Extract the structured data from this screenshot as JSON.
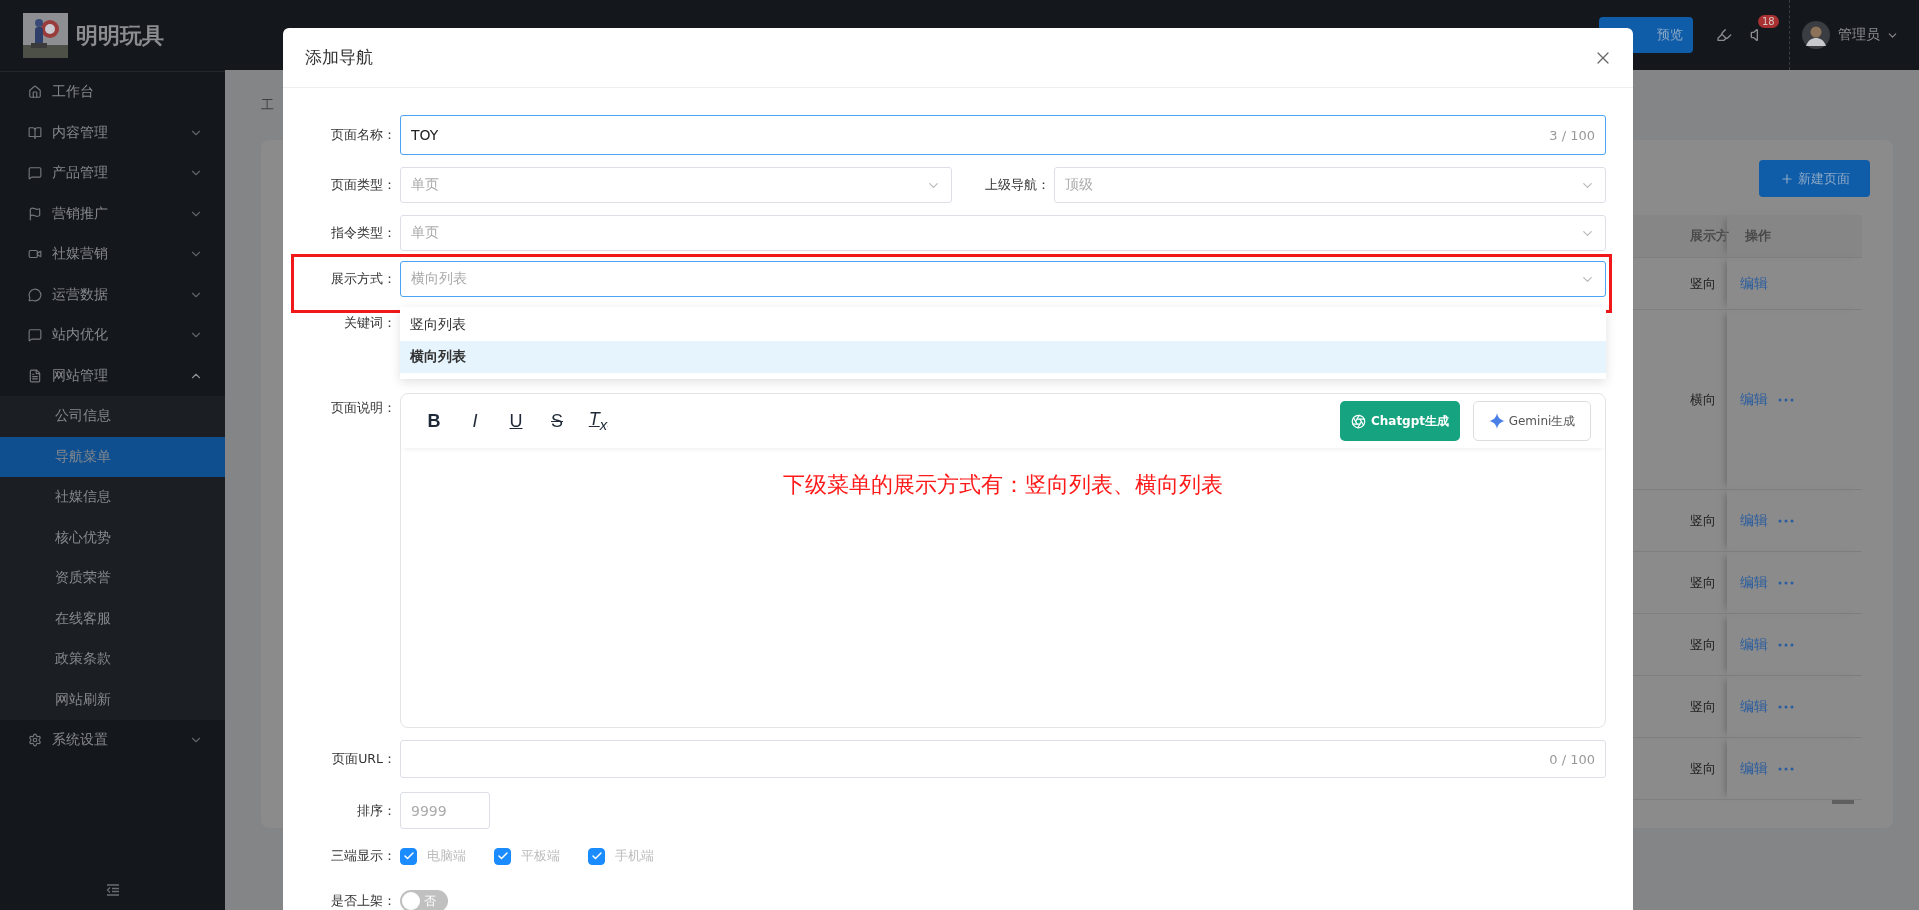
{
  "sidebar": {
    "brand": "明明玩具",
    "items": [
      {
        "label": "工作台",
        "kind": "home"
      },
      {
        "label": "内容管理",
        "kind": "book",
        "expanded": false
      },
      {
        "label": "产品管理",
        "kind": "card",
        "expanded": false
      },
      {
        "label": "营销推广",
        "kind": "flag",
        "expanded": false
      },
      {
        "label": "社媒营销",
        "kind": "video",
        "expanded": false
      },
      {
        "label": "运营数据",
        "kind": "chat",
        "expanded": false
      },
      {
        "label": "站内优化",
        "kind": "card",
        "expanded": false
      },
      {
        "label": "网站管理",
        "kind": "file",
        "expanded": true,
        "children": [
          {
            "label": "公司信息",
            "selected": false
          },
          {
            "label": "导航菜单",
            "selected": true
          },
          {
            "label": "社媒信息",
            "selected": false
          },
          {
            "label": "核心优势",
            "selected": false
          },
          {
            "label": "资质荣誉",
            "selected": false
          },
          {
            "label": "在线客服",
            "selected": false
          },
          {
            "label": "政策条款",
            "selected": false
          },
          {
            "label": "网站刷新",
            "selected": false
          }
        ]
      },
      {
        "label": "系统设置",
        "kind": "gear",
        "expanded": false
      }
    ]
  },
  "topbar": {
    "preview_button": "预览",
    "notification_count": "18",
    "user": "管理员"
  },
  "breadcrumb": "工",
  "page": {
    "new_button": "新建页面",
    "table": {
      "columns": [
        "展示方",
        "操作"
      ],
      "rows": [
        {
          "display": "竖向",
          "action": "编辑",
          "more": false
        },
        {
          "display": "横向",
          "action": "编辑",
          "more": true
        },
        {
          "display": "竖向",
          "action": "编辑",
          "more": true
        },
        {
          "display": "竖向",
          "action": "编辑",
          "more": true
        },
        {
          "display": "竖向",
          "action": "编辑",
          "more": true
        },
        {
          "display": "竖向",
          "action": "编辑",
          "more": true
        },
        {
          "display": "竖向",
          "action": "编辑",
          "more": true
        }
      ]
    }
  },
  "modal": {
    "title": "添加导航",
    "name_field": {
      "label": "页面名称：",
      "value": "TOY",
      "counter": "3 / 100"
    },
    "page_type": {
      "label": "页面类型：",
      "value": "单页"
    },
    "parent_nav": {
      "label": "上级导航：",
      "value": "顶级"
    },
    "command_type": {
      "label": "指令类型：",
      "value": "单页"
    },
    "display_mode": {
      "label": "展示方式：",
      "placeholder": "横向列表",
      "highlighted": true,
      "options": [
        {
          "label": "竖向列表",
          "selected": false
        },
        {
          "label": "横向列表",
          "selected": true
        }
      ]
    },
    "keywords": {
      "label": "关键词："
    },
    "description": {
      "label": "页面说明：",
      "toolbar": [
        {
          "kind": "bold",
          "label": "B"
        },
        {
          "kind": "italic",
          "label": "I"
        },
        {
          "kind": "underline",
          "label": "U"
        },
        {
          "kind": "strike",
          "label": "S"
        },
        {
          "kind": "clear",
          "label": "T$_{x}$"
        }
      ],
      "chatgpt_button": "Chatgpt生成",
      "gemini_button": "Gemini生成",
      "content": "下级菜单的展示方式有：竖向列表、横向列表"
    },
    "url": {
      "label": "页面URL：",
      "counter": "0 / 100"
    },
    "sort": {
      "label": "排序：",
      "placeholder": "9999"
    },
    "platforms": {
      "label": "三端显示：",
      "options": [
        {
          "label": "电脑端",
          "checked": true
        },
        {
          "label": "平板端",
          "checked": true
        },
        {
          "label": "手机端",
          "checked": true
        }
      ]
    },
    "publish": {
      "label": "是否上架：",
      "on": false,
      "state_label": "否"
    }
  }
}
